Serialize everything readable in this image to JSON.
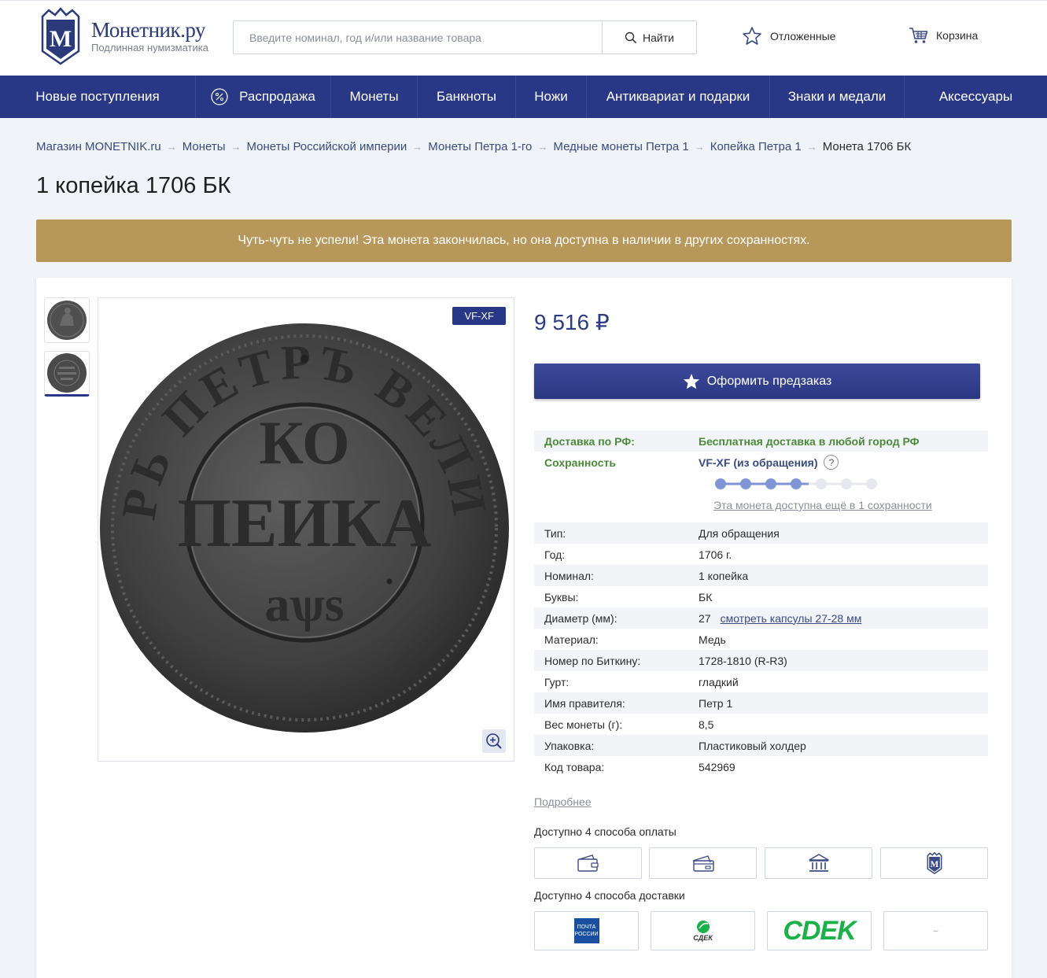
{
  "header": {
    "logo_name": "Монетник.ру",
    "logo_tagline": "Подлинная нумизматика",
    "search_placeholder": "Введите номинал, год и/или название товара",
    "search_button": "Найти",
    "wishlist": "Отложенные",
    "cart": "Корзина"
  },
  "nav": [
    {
      "label": "Новые поступления"
    },
    {
      "label": "Распродажа",
      "icon": "percent-icon"
    },
    {
      "label": "Монеты"
    },
    {
      "label": "Банкноты"
    },
    {
      "label": "Ножи"
    },
    {
      "label": "Антиквариат и подарки"
    },
    {
      "label": "Знаки и медали"
    },
    {
      "label": "Аксессуары"
    }
  ],
  "breadcrumb": [
    "Магазин MONETNIK.ru",
    "Монеты",
    "Монеты Российской империи",
    "Монеты Петра 1-го",
    "Медные монеты Петра 1",
    "Копейка Петра 1",
    "Монета 1706 БК"
  ],
  "product": {
    "title": "1 копейка 1706 БК",
    "banner": "Чуть-чуть не успели! Эта монета закончилась, но она доступна в наличии в других сохранностях.",
    "grade_badge": "VF-XF",
    "price": "9 516 ₽",
    "order_button": "Оформить предзаказ",
    "delivery_label": "Доставка по РФ:",
    "delivery_value": "Бесплатная доставка в любой город РФ",
    "condition_label": "Сохранность",
    "condition_value": "VF-XF (из обращения)",
    "condition_help": "?",
    "condition_level": 4,
    "condition_max": 7,
    "condition_link": "Эта монета доступна ещё в 1 сохранности",
    "more_link": "Подробнее",
    "payment_title": "Доступно 4 способа оплаты",
    "delivery_title": "Доступно 4 способа доставки",
    "specs": [
      {
        "label": "Тип:",
        "value": "Для обращения"
      },
      {
        "label": "Год:",
        "value": "1706 г."
      },
      {
        "label": "Номинал:",
        "value": "1 копейка"
      },
      {
        "label": "Буквы:",
        "value": "БК"
      },
      {
        "label": "Диаметр (мм):",
        "value": "27",
        "link": "смотреть капсулы 27-28 мм"
      },
      {
        "label": "Материал:",
        "value": "Медь"
      },
      {
        "label": "Номер по Биткину:",
        "value": "1728-1810 (R-R3)"
      },
      {
        "label": "Гурт:",
        "value": "гладкий"
      },
      {
        "label": "Имя правителя:",
        "value": "Петр 1"
      },
      {
        "label": "Вес монеты (г):",
        "value": "8,5"
      },
      {
        "label": "Упаковка:",
        "value": "Пластиковый холдер"
      },
      {
        "label": "Код товара:",
        "value": "542969"
      }
    ],
    "payment_methods": [
      "wallet-icon",
      "card-icon",
      "bank-icon",
      "monetnik-icon"
    ],
    "delivery_methods": [
      {
        "icon": "russian-post-logo",
        "text": "ПОЧТА РОССИИ"
      },
      {
        "icon": "sdek-small-logo",
        "text": "СДЕК"
      },
      {
        "icon": "cdek-logo",
        "text": "CDEK"
      },
      {
        "icon": "dash-icon",
        "text": "–"
      }
    ]
  },
  "colors": {
    "brand": "#283786",
    "banner": "#b8975a",
    "green": "#4a8a3a",
    "cdek": "#1ab248"
  }
}
